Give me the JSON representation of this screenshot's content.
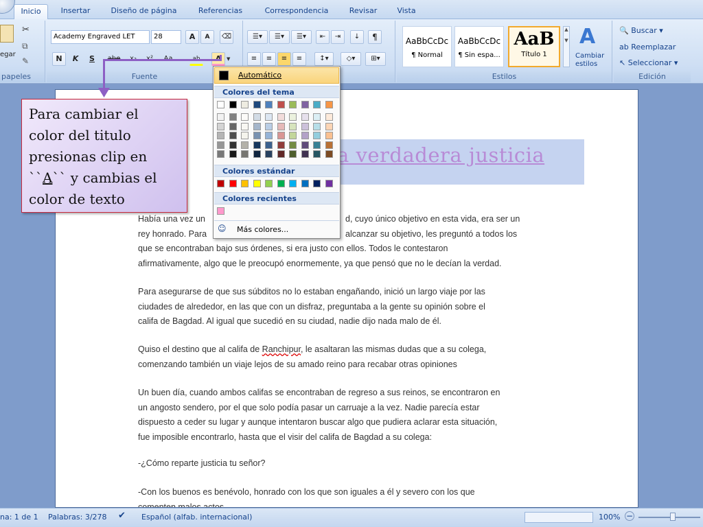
{
  "tabs": [
    "Inicio",
    "Insertar",
    "Diseño de página",
    "Referencias",
    "Correspondencia",
    "Revisar",
    "Vista"
  ],
  "ribbon": {
    "clipboard": {
      "paste_label": "egar",
      "group_label": "papeles"
    },
    "font": {
      "font_name": "Academy Engraved LET",
      "font_size": "28",
      "group_label": "Fuente",
      "bold": "N",
      "italic": "K",
      "underline": "S",
      "strike": "abe",
      "sub": "x₂",
      "sup": "x²",
      "case": "Aa",
      "highlight": "ab",
      "color": "A",
      "grow": "A",
      "shrink": "A"
    },
    "styles": {
      "group_label": "Estilos",
      "items": [
        {
          "sample": "AaBbCcDc",
          "name": "¶ Normal"
        },
        {
          "sample": "AaBbCcDc",
          "name": "¶ Sin espa..."
        },
        {
          "sample": "AaB",
          "name": "Título 1"
        }
      ],
      "change_label_1": "Cambiar",
      "change_label_2": "estilos"
    },
    "editing": {
      "group_label": "Edición",
      "find": "Buscar",
      "replace": "Reemplazar",
      "select": "Seleccionar"
    }
  },
  "palette": {
    "automatic": "Automático",
    "theme_header": "Colores del tema",
    "standard_header": "Colores estándar",
    "recent_header": "Colores recientes",
    "more": "Más colores...",
    "theme_top": [
      "#ffffff",
      "#000000",
      "#eeece1",
      "#1f497d",
      "#4f81bd",
      "#c0504d",
      "#9bbb59",
      "#8064a2",
      "#4bacc6",
      "#f79646"
    ],
    "standard": [
      "#c00000",
      "#ff0000",
      "#ffc000",
      "#ffff00",
      "#92d050",
      "#00b050",
      "#00b0f0",
      "#0070c0",
      "#002060",
      "#7030a0"
    ],
    "recent": [
      "#ff99cc"
    ]
  },
  "callout": {
    "line1": "Para cambiar el",
    "line2": "color del titulo",
    "line3": "presionas clip en",
    "line4a": "``",
    "line4b": "A",
    "line4c": "``   y cambias el",
    "line5": "color de texto"
  },
  "document": {
    "title": "a verdadera justicia",
    "p1": [
      "Había una vez un",
      "d, cuyo único objetivo en esta vida, era  ser un",
      "rey honrado. Para",
      "alcanzar  su objetivo, les preguntó a todos los",
      "que se encontraban  bajo sus órdenes,  si era justo con ellos. Todos le contestaron",
      "afirmativamente, algo que le preocupó enormemente,  ya que pensó que no le decían  la verdad."
    ],
    "p2": [
      "Para asegurarse  de que sus súbditos no lo estaban engañando, inició un largo viaje  por las",
      "ciudades de alrededor, en las que con un disfraz, preguntaba a la  gente su opinión sobre el",
      "califa de Bagdad. Al igual que sucedió en su ciudad, nadie dijo nada malo de él."
    ],
    "p3a": "Quiso el destino que al califa de ",
    "p3b": "Ranchipur",
    "p3c": ", le asaltaran  las mismas dudas que a su colega,",
    "p3d": "comenzando también un  viaje lejos de su amado reino para recabar otras opiniones",
    "p4": [
      "Un buen día, cuando ambos califas se encontraban  de regreso a sus reinos, se encontraron  en",
      "un angosto sendero, por el que solo podía pasar un carruaje  a la vez. Nadie parecía  estar",
      "dispuesto a ceder su lugar y aunque  intentaron  buscar algo que pudiera  aclarar esta situación,",
      "fue imposible encontrarlo, hasta que el visir del califa de Bagdad a su colega:"
    ],
    "p5": "-¿Cómo reparte justicia tu señor?",
    "p6": [
      "-Con los buenos es benévolo, honrado con los que son iguales a él y severo con los que",
      "comenten malos actos"
    ]
  },
  "status": {
    "page": "na: 1 de 1",
    "words": "Palabras: 3/278",
    "lang": "Español (alfab. internacional)",
    "zoom": "100%"
  }
}
